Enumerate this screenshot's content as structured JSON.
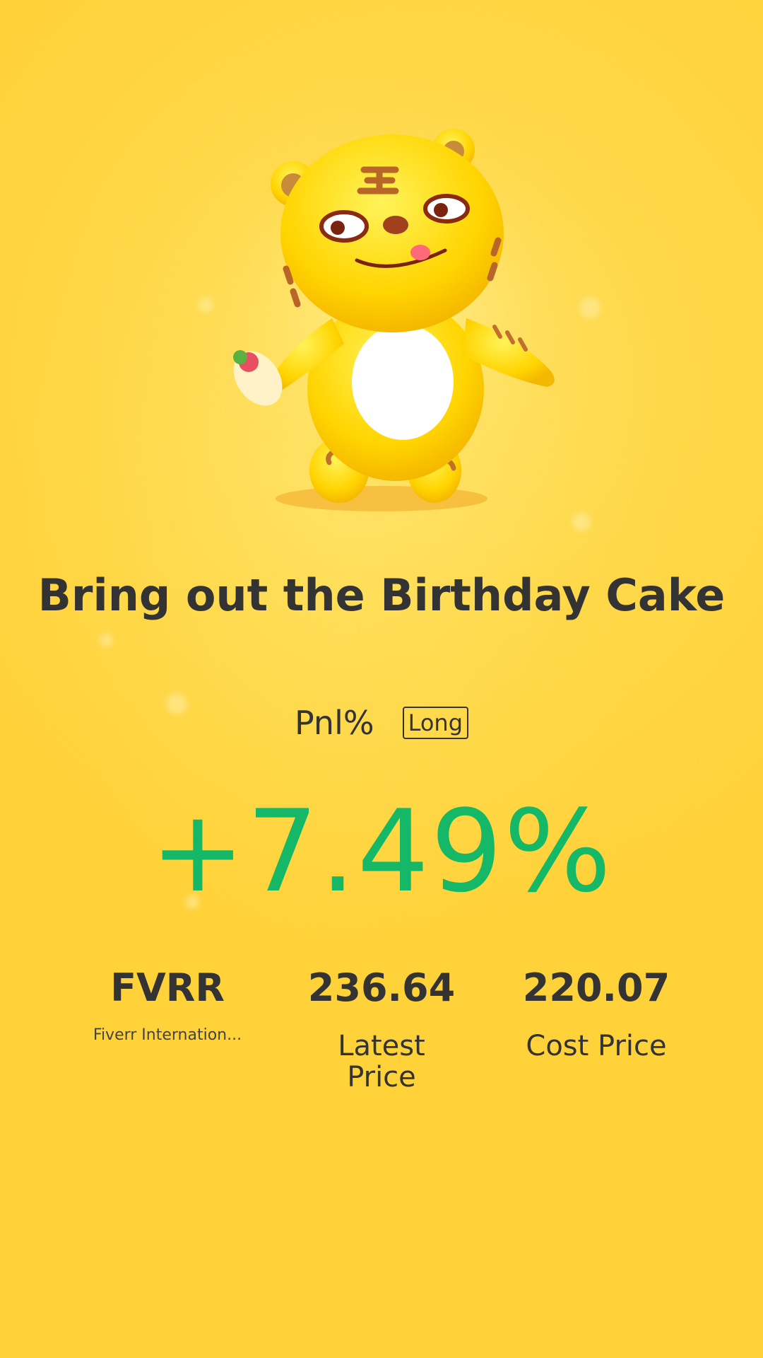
{
  "mascot": {
    "icon": "tiger-mascot-icon"
  },
  "title": "Bring out the Birthday Cake",
  "pnl": {
    "label": "Pnl%",
    "direction": "Long",
    "value": "+7.49%",
    "value_color": "#14b866"
  },
  "stats": [
    {
      "value": "FVRR",
      "sub": "Fiverr Internation..."
    },
    {
      "value": "236.64",
      "label": "Latest\nPrice"
    },
    {
      "value": "220.07",
      "label": "Cost Price"
    }
  ],
  "colors": {
    "background": "#ffd23a",
    "text": "#333333",
    "positive": "#14b866"
  }
}
